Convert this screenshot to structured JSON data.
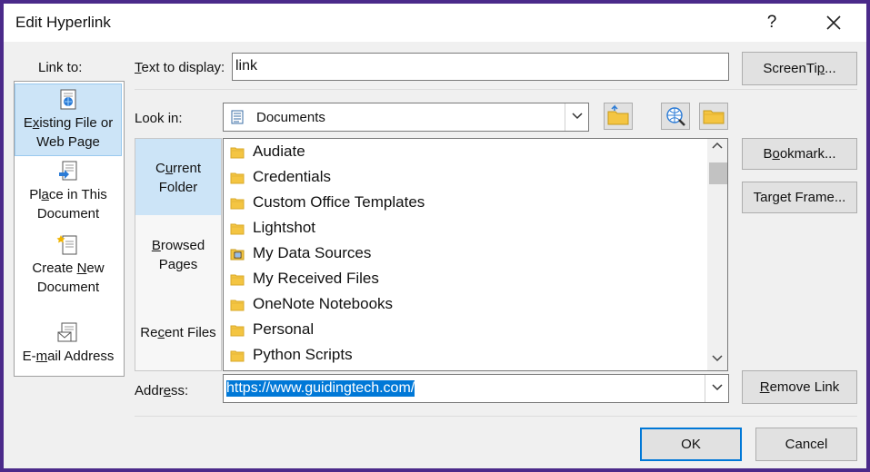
{
  "window": {
    "title": "Edit Hyperlink",
    "help_label": "?"
  },
  "link_to": {
    "heading": "Link to:",
    "items": [
      {
        "pre": "E",
        "u": "x",
        "post": "isting File or",
        "line2": "Web Page",
        "selected": true
      },
      {
        "pre": "Pl",
        "u": "a",
        "post": "ce in This",
        "line2": "Document",
        "selected": false
      },
      {
        "pre": "Create ",
        "u": "N",
        "post": "ew",
        "line2": "Document",
        "selected": false
      },
      {
        "pre": "E-",
        "u": "m",
        "post": "ail Address",
        "line2": "",
        "selected": false
      }
    ]
  },
  "text_to_display": {
    "label_u": "T",
    "label_rest": "ext to display:",
    "value": "link"
  },
  "screentip_button": {
    "pre": "ScreenTi",
    "u": "p",
    "post": "..."
  },
  "look_in": {
    "label_pre": "Look in",
    "label_post": ":",
    "value": "Documents"
  },
  "look_in_icons": [
    "folder-up-icon",
    "browse-web-icon",
    "browse-file-icon"
  ],
  "look_panel": {
    "items": [
      {
        "line1_pre": "C",
        "line1_u": "u",
        "line1_post": "rrent",
        "line2": "Folder",
        "selected": true
      },
      {
        "line1_pre": "",
        "line1_u": "B",
        "line1_post": "rowsed",
        "line2": "Pages",
        "selected": false
      },
      {
        "line1_pre": "Re",
        "line1_u": "c",
        "line1_post": "ent Files",
        "line2": "",
        "selected": false
      }
    ]
  },
  "files": [
    {
      "name": "Audiate",
      "icon": "folder-icon"
    },
    {
      "name": "Credentials",
      "icon": "folder-icon"
    },
    {
      "name": "Custom Office Templates",
      "icon": "folder-icon"
    },
    {
      "name": "Lightshot",
      "icon": "folder-icon"
    },
    {
      "name": "My Data Sources",
      "icon": "data-source-icon"
    },
    {
      "name": "My Received Files",
      "icon": "folder-icon"
    },
    {
      "name": "OneNote Notebooks",
      "icon": "folder-icon"
    },
    {
      "name": "Personal",
      "icon": "folder-icon"
    },
    {
      "name": "Python Scripts",
      "icon": "folder-icon"
    }
  ],
  "right_buttons": {
    "bookmark": {
      "pre": "B",
      "u": "o",
      "post": "okmark..."
    },
    "target_frame": {
      "pre": "Tar",
      "u": "g",
      "post": "et Frame..."
    },
    "remove_link": {
      "pre": "",
      "u": "R",
      "post": "emove Link"
    }
  },
  "address": {
    "label_pre": "Addr",
    "label_u": "e",
    "label_post": "ss:",
    "value": "https://www.guidingtech.com/"
  },
  "footer": {
    "ok_label": "OK",
    "cancel_label": "Cancel"
  },
  "colors": {
    "accent": "#0078d7",
    "selection": "#cce4f7",
    "folder": "#f4c542",
    "frame": "#4b2a8a"
  }
}
